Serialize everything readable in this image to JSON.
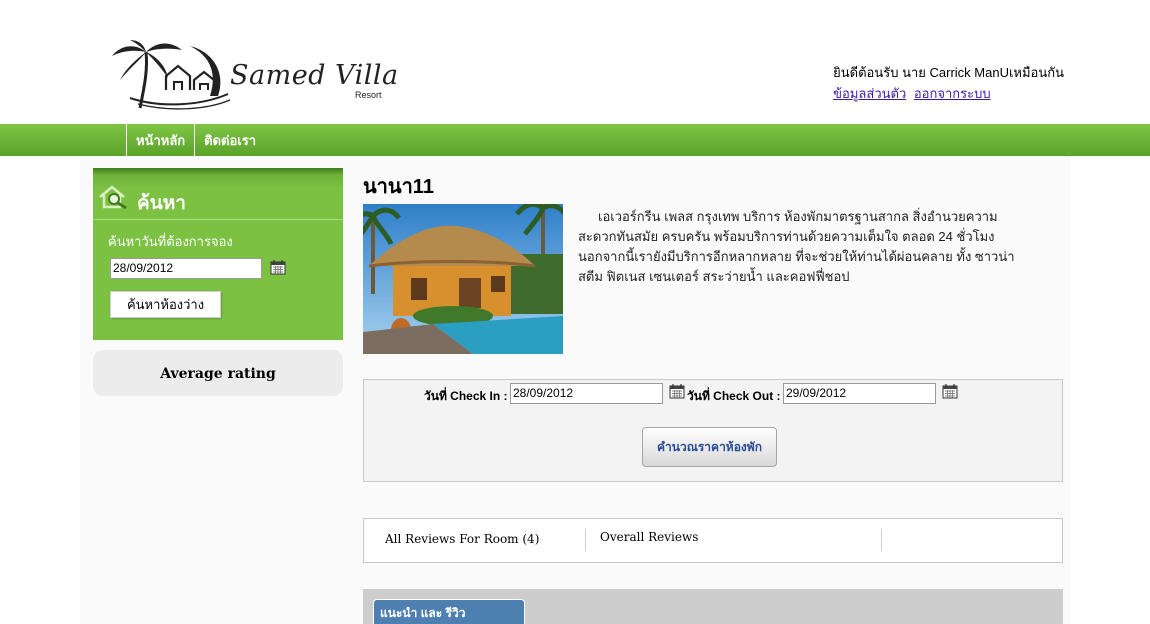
{
  "header": {
    "logo_name": "Samed Villa",
    "logo_sub": "Resort",
    "welcome_text": "ยินดีต้อนรับ นาย Carrick ManUเหมือนกัน",
    "links": {
      "profile": "ข้อมูลส่วนตัว",
      "logout": "ออกจากระบบ"
    }
  },
  "nav": {
    "items": [
      {
        "label": "หน้าหลัก"
      },
      {
        "label": "ติดต่อเรา"
      }
    ]
  },
  "sidebar": {
    "search_title": "ค้นหา",
    "search_label": "ค้นหาวันที่ต้องการจอง",
    "search_date": "28/09/2012",
    "search_button": "ค้นหาห้องว่าง",
    "rating_title": "Average rating"
  },
  "room": {
    "title": "นานา11",
    "description": "เอเวอร์กรีน เพลส กรุงเทพ บริการ ห้องพักมาตรฐานสากล สิ่งอำนวยความสะดวกทันสมัย ครบครัน พร้อมบริการท่านด้วยความเต็มใจ ตลอด 24 ชั่วโมง นอกจากนี้เรายังมีบริการอีกหลากหลาย ที่จะช่วยให้ท่านได้ผ่อนคลาย ทั้ง ซาวน่า สตีม ฟิตเนส เซนเตอร์ สระว่ายน้ำ และคอฟฟี่ชอป"
  },
  "booking": {
    "checkin_label": "วันที่ Check In :",
    "checkin_value": "28/09/2012",
    "checkout_label": "วันที่ Check Out :",
    "checkout_value": "29/09/2012",
    "calc_button": "คำนวณราคาห้องพัก"
  },
  "reviews": {
    "tab_all": "All Reviews For Room (4)",
    "tab_overall": "Overall Reviews"
  },
  "bottom": {
    "tab_label": "แนะนำ และ รีวิว"
  },
  "colors": {
    "nav_green": "#6ab536",
    "sidebar_green": "#7dc143",
    "link": "#3b1aa8",
    "tab_blue": "#4d7fb0"
  }
}
